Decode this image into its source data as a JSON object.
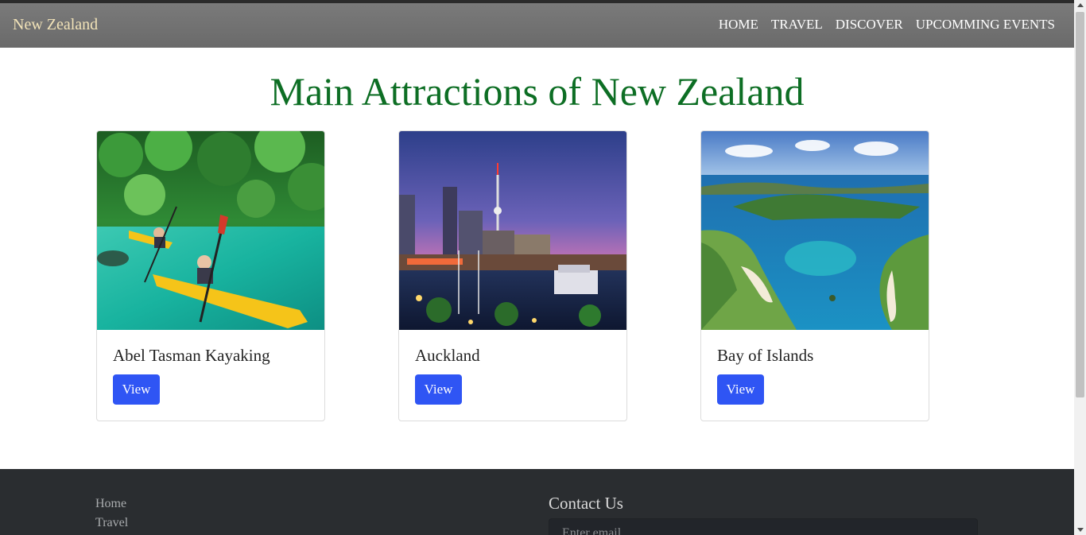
{
  "navbar": {
    "brand": "New Zealand",
    "links": [
      "HOME",
      "TRAVEL",
      "DISCOVER",
      "UPCOMMING EVENTS"
    ]
  },
  "main": {
    "title": "Main Attractions of New Zealand",
    "cards": [
      {
        "title": "Abel Tasman Kayaking",
        "button": "View"
      },
      {
        "title": "Auckland",
        "button": "View"
      },
      {
        "title": "Bay of Islands",
        "button": "View"
      }
    ]
  },
  "footer": {
    "links": [
      "Home",
      "Travel"
    ],
    "contact_title": "Contact Us",
    "email_placeholder": "Enter email"
  },
  "colors": {
    "brand": "#f2e3b8",
    "title_green": "#0d6e24",
    "button_blue": "#2f55f4",
    "footer_bg": "#2a2d30"
  }
}
